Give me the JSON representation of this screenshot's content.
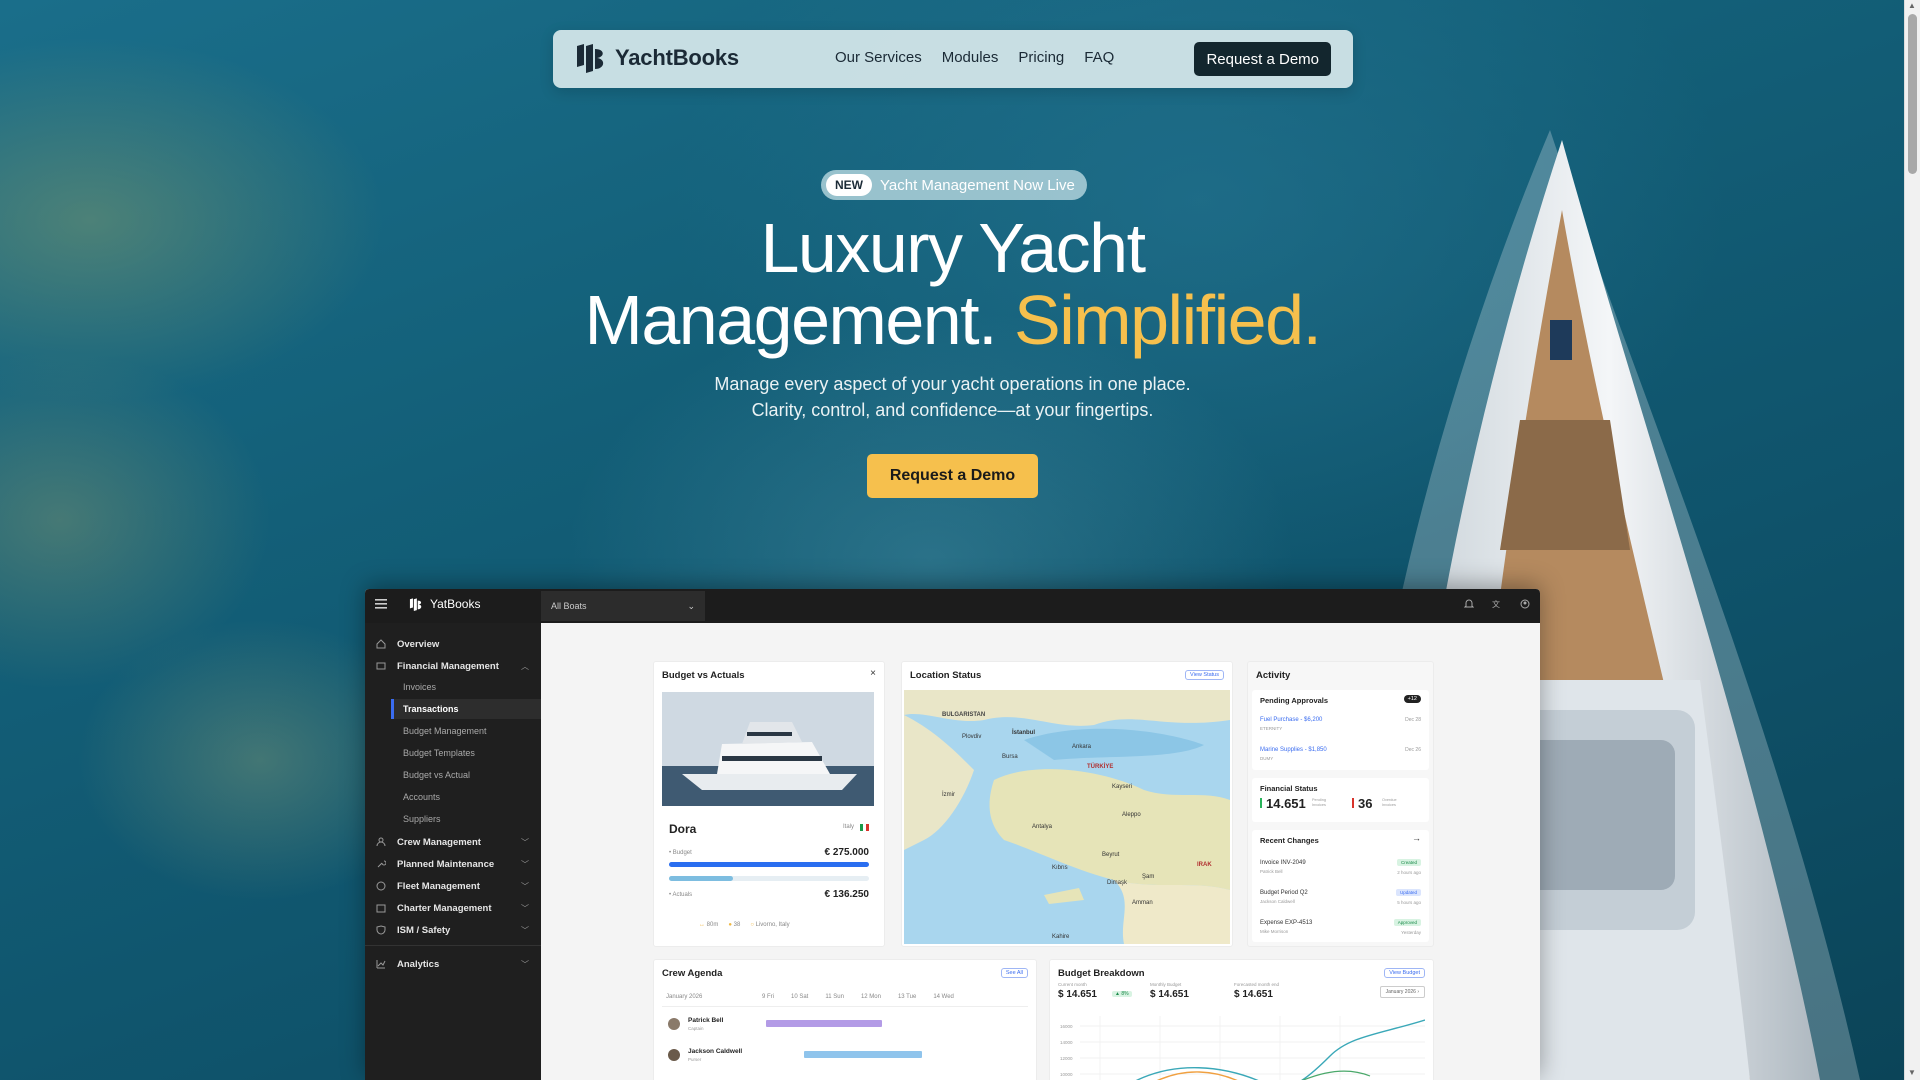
{
  "nav": {
    "brand": "YachtBooks",
    "links": [
      "Our Services",
      "Modules",
      "Pricing",
      "FAQ"
    ],
    "cta": "Request a Demo"
  },
  "hero": {
    "badge_tag": "NEW",
    "badge_text": "Yacht Management Now Live",
    "title_line1": "Luxury Yacht",
    "title_line2_a": "Management.",
    "title_line2_b": "Simplified.",
    "subtitle_line1": "Manage every aspect of your yacht operations in one place.",
    "subtitle_line2": "Clarity, control, and confidence—at your fingertips.",
    "cta": "Request a Demo",
    "accent_color": "#f6c04d"
  },
  "dashboard": {
    "brand": "YatBooks",
    "boat_selector": "All Boats",
    "sidebar": {
      "overview": "Overview",
      "financial": "Financial Management",
      "financial_items": [
        "Invoices",
        "Transactions",
        "Budget Management",
        "Budget Templates",
        "Budget vs Actual",
        "Accounts",
        "Suppliers"
      ],
      "active_item": "Transactions",
      "sections": [
        "Crew Management",
        "Planned Maintenance",
        "Fleet Management",
        "Charter Management",
        "ISM / Safety"
      ],
      "analytics": "Analytics"
    },
    "budget_card": {
      "title": "Budget vs Actuals",
      "boat_name": "Dora",
      "flag": "Italy",
      "budget_label": "Budget",
      "budget_value": "€ 275.000",
      "actuals_label": "Actuals",
      "actuals_value": "€ 136.250",
      "actuals_fraction": 0.32,
      "length": "80m",
      "guests": "38",
      "port": "Livorno, Italy"
    },
    "location_card": {
      "title": "Location Status",
      "button": "View Status",
      "map_labels": [
        "BULGARISTAN",
        "İstanbul",
        "Ankara",
        "TÜRKİYE",
        "Beyrut",
        "Amman",
        "Kahire",
        "Aleppo",
        "IRAK",
        "Şam",
        "Dimaşk",
        "Plovdiv",
        "Bursa",
        "Kayseri",
        "Antalya",
        "İzmir",
        "Kıbrıs"
      ]
    },
    "activity_card": {
      "title": "Activity",
      "pending_title": "Pending Approvals",
      "pending_count": "+12",
      "pending_items": [
        {
          "label": "Fuel Purchase - $6,200",
          "sub": "ETERNITY",
          "date": "Dec 28"
        },
        {
          "label": "Marine Supplies - $1,850",
          "sub": "DUMY",
          "date": "Dec 26"
        }
      ],
      "financial_title": "Financial Status",
      "financial_value_1": "14.651",
      "financial_label_1": "Pending Invoices",
      "financial_value_2": "36",
      "financial_label_2": "Overdue Invoices",
      "recent_title": "Recent Changes",
      "recent_items": [
        {
          "label": "Invoice INV-2049",
          "sub": "Patrick Bell",
          "status": "Created",
          "time": "2 hours ago"
        },
        {
          "label": "Budget Period Q2",
          "sub": "Jackson Caldwell",
          "status": "Updated",
          "time": "5 hours ago"
        },
        {
          "label": "Expense EXP-4513",
          "sub": "Mike Morrison",
          "status": "Approved",
          "time": "Yesterday"
        }
      ]
    },
    "crew_card": {
      "title": "Crew Agenda",
      "button": "See All",
      "month": "January 2026",
      "days": [
        "9 Fri",
        "10 Sat",
        "11 Sun",
        "12 Mon",
        "13 Tue",
        "14 Wed"
      ],
      "members": [
        {
          "name": "Patrick Bell",
          "role": "Captain"
        },
        {
          "name": "Jackson Caldwell",
          "role": "Purser"
        }
      ]
    },
    "breakdown_card": {
      "title": "Budget Breakdown",
      "button": "View Budget",
      "period": "January 2026",
      "kpis": [
        {
          "label": "Current month",
          "value": "$ 14.651",
          "delta": "8%"
        },
        {
          "label": "Monthly Budget",
          "value": "$ 14.651"
        },
        {
          "label": "Forecasted month end",
          "value": "$ 14.651"
        }
      ],
      "y_ticks": [
        "16000",
        "14000",
        "12000",
        "10000"
      ]
    }
  }
}
